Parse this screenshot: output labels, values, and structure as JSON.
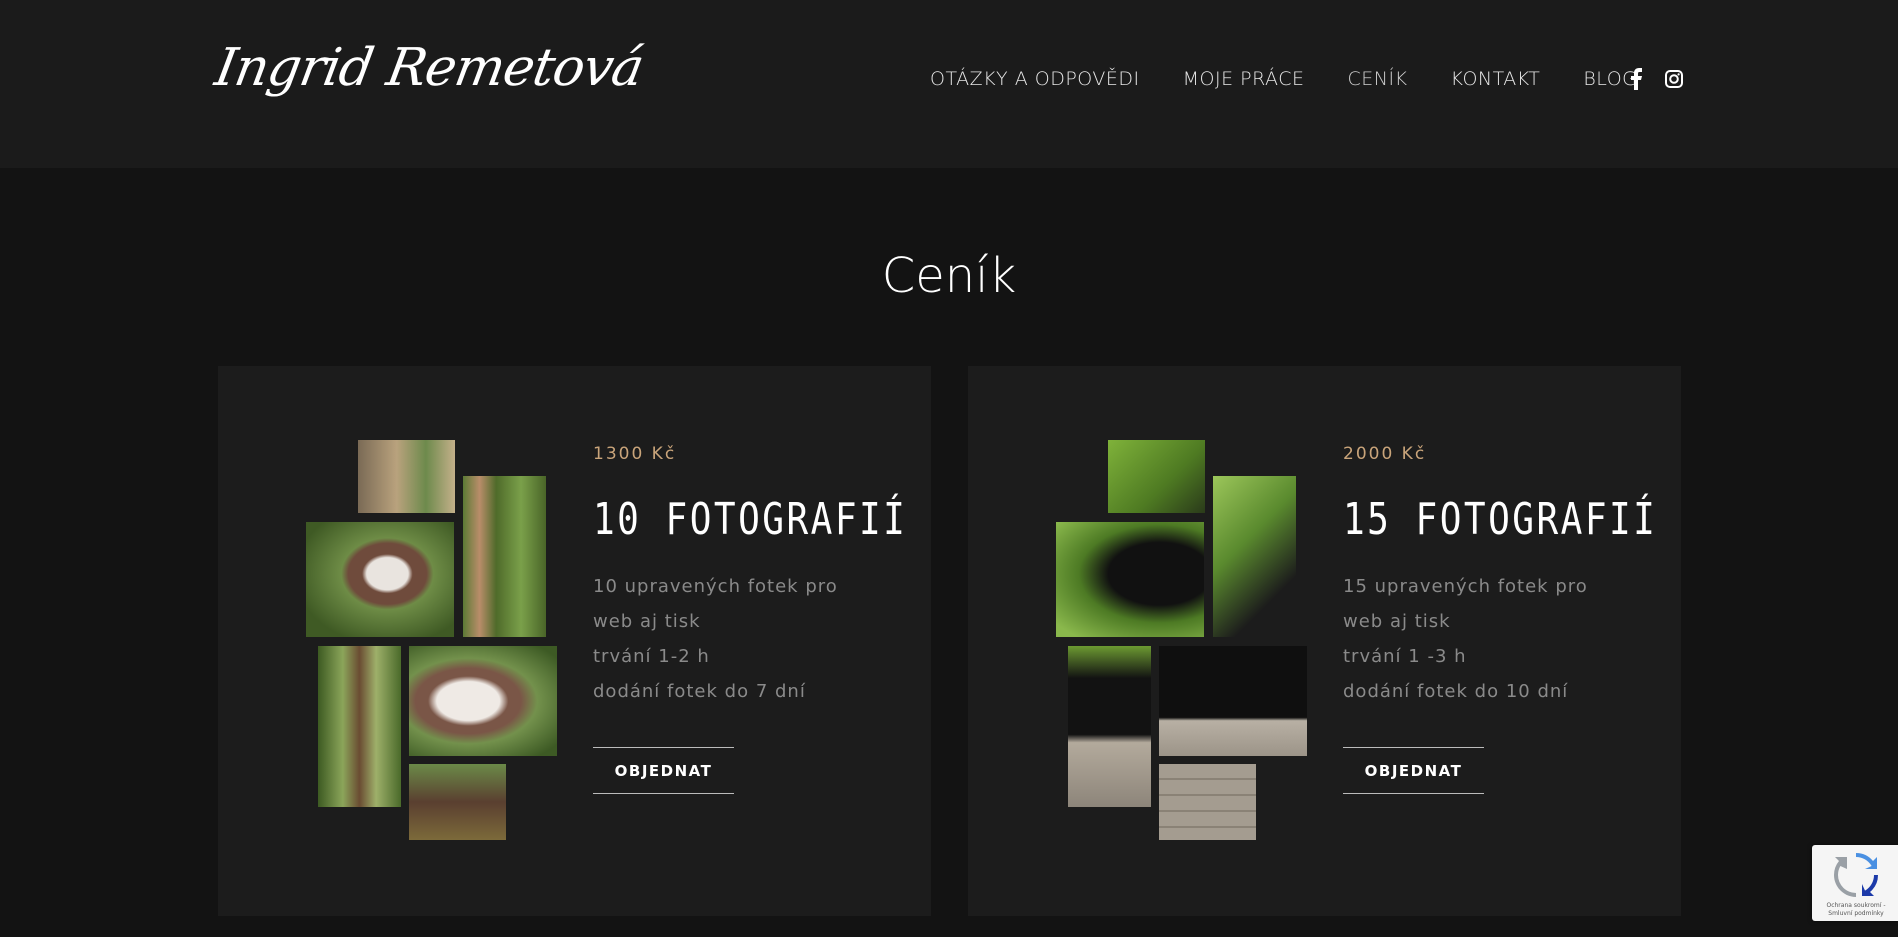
{
  "header": {
    "logo_text": "Ingrid Remetová",
    "nav": [
      {
        "label": "OTÁZKY A ODPOVĚDI"
      },
      {
        "label": "MOJE PRÁCE"
      },
      {
        "label": "CENÍK"
      },
      {
        "label": "KONTAKT"
      },
      {
        "label": "BLOG"
      }
    ],
    "social": [
      "facebook-icon",
      "instagram-icon"
    ]
  },
  "page_title": "Ceník",
  "packages": [
    {
      "price": "1300 Kč",
      "name": "10 FOTOGRAFIÍ",
      "features": [
        "10 upravených fotek pro",
        "web aj tisk",
        "trvání 1-2 h",
        "dodání fotek do 7 dní"
      ],
      "button": "OBJEDNAT"
    },
    {
      "price": "2000 Kč",
      "name": "15 FOTOGRAFIÍ",
      "features": [
        "15 upravených fotek pro",
        "web aj tisk",
        "trvání 1 -3 h",
        "dodání fotek do 10 dní"
      ],
      "button": "OBJEDNAT"
    }
  ],
  "recaptcha": {
    "text": "Ochrana soukromí - Smluvní podmínky"
  },
  "colors": {
    "accent": "#c9a47a",
    "header_bg": "#1b1b1b",
    "page_bg": "#131313",
    "card_bg": "#1c1c1c"
  }
}
